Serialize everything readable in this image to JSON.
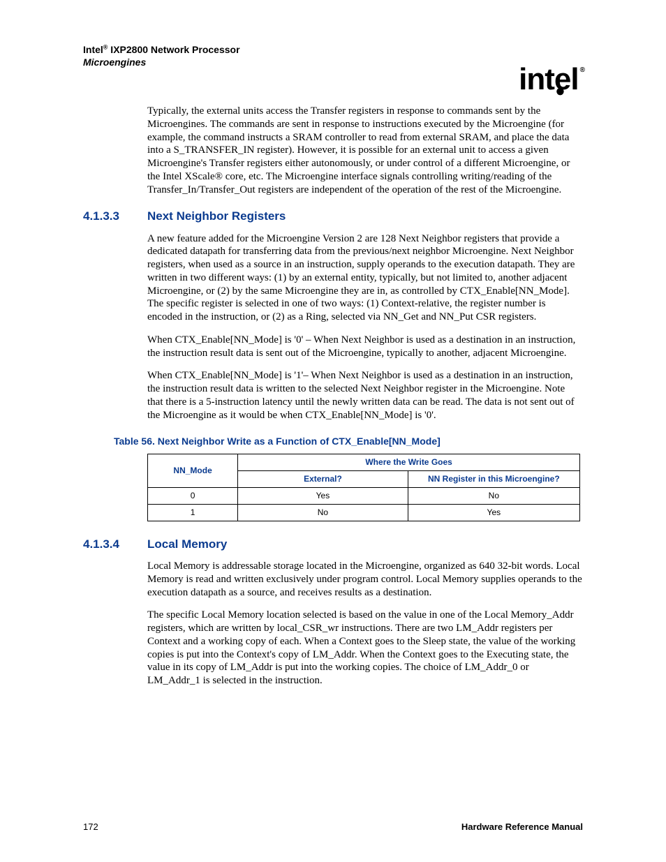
{
  "header": {
    "title_pre": "Intel",
    "title_sup": "®",
    "title_post": " IXP2800 Network Processor",
    "subtitle": "Microengines",
    "logo_text": "intel",
    "logo_reg": "®"
  },
  "intro_para": "Typically, the external units access the Transfer registers in response to commands sent by the Microengines. The commands are sent in response to instructions executed by the Microengine (for example, the command instructs a SRAM controller to read from external SRAM, and place the data into a S_TRANSFER_IN register). However, it is possible for an external unit to access a given Microengine's Transfer registers either autonomously, or under control of a different Microengine, or the Intel XScale® core, etc. The Microengine interface signals controlling writing/reading of the Transfer_In/Transfer_Out registers are independent of the operation of the rest of the Microengine.",
  "section_4133": {
    "num": "4.1.3.3",
    "title": "Next Neighbor Registers",
    "p1": "A new feature added for the Microengine Version 2 are 128 Next Neighbor registers that provide a dedicated datapath for transferring data from the previous/next neighbor Microengine. Next Neighbor registers, when used as a source in an instruction, supply operands to the execution datapath. They are written in two different ways: (1) by an external entity, typically, but not limited to, another adjacent Microengine, or (2) by the same Microengine they are in, as controlled by CTX_Enable[NN_Mode]. The specific register is selected in one of two ways: (1) Context-relative, the register number is encoded in the instruction, or (2) as a Ring, selected via NN_Get and NN_Put CSR registers.",
    "p2": "When CTX_Enable[NN_Mode] is '0' – When Next Neighbor is used as a destination in an instruction, the instruction result data is sent out of the Microengine, typically to another, adjacent Microengine.",
    "p3": "When CTX_Enable[NN_Mode] is '1'– When Next Neighbor is used as a destination in an instruction, the instruction result data is written to the selected Next Neighbor register in the Microengine. Note that there is a 5-instruction latency until the newly written data can be read. The data is not sent out of the Microengine as it would be when CTX_Enable[NN_Mode] is '0'."
  },
  "table56": {
    "caption": "Table 56.  Next Neighbor Write as a Function of CTX_Enable[NN_Mode]",
    "h_col1": "NN_Mode",
    "h_span": "Where the Write Goes",
    "h_col2": "External?",
    "h_col3": "NN Register in this Microengine?",
    "rows": [
      {
        "mode": "0",
        "ext": "Yes",
        "nn": "No"
      },
      {
        "mode": "1",
        "ext": "No",
        "nn": "Yes"
      }
    ]
  },
  "section_4134": {
    "num": "4.1.3.4",
    "title": "Local Memory",
    "p1": "Local Memory is addressable storage located in the Microengine, organized as 640 32-bit words. Local Memory is read and written exclusively under program control. Local Memory supplies operands to the execution datapath as a source, and receives results as a destination.",
    "p2": "The specific Local Memory location selected is based on the value in one of the Local Memory_Addr registers, which are written by local_CSR_wr instructions. There are two LM_Addr registers per Context and a working copy of each. When a Context goes to the Sleep state, the value of the working copies is put into the Context's copy of LM_Addr. When the Context goes to the Executing state, the value in its copy of LM_Addr is put into the working copies. The choice of LM_Addr_0 or LM_Addr_1 is selected in the instruction."
  },
  "footer": {
    "page": "172",
    "doc": "Hardware Reference Manual"
  },
  "chart_data": {
    "type": "table",
    "title": "Next Neighbor Write as a Function of CTX_Enable[NN_Mode]",
    "columns": [
      "NN_Mode",
      "External?",
      "NN Register in this Microengine?"
    ],
    "rows": [
      [
        "0",
        "Yes",
        "No"
      ],
      [
        "1",
        "No",
        "Yes"
      ]
    ]
  }
}
